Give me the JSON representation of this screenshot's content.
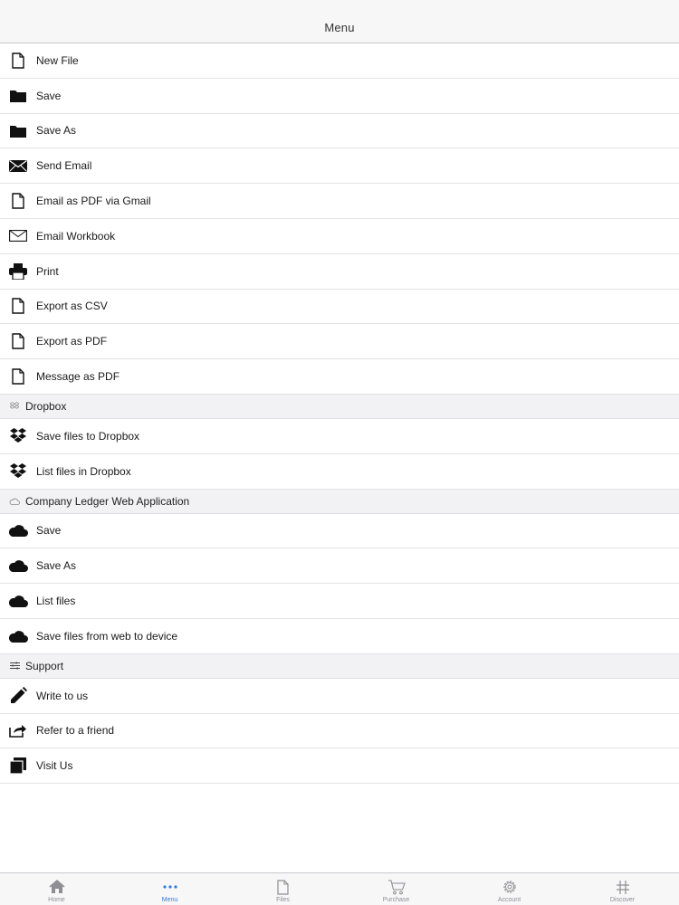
{
  "nav": {
    "title": "Menu"
  },
  "menu": {
    "file_items": [
      {
        "label": "New File",
        "icon": "file-icon"
      },
      {
        "label": "Save",
        "icon": "folder-icon"
      },
      {
        "label": "Save As",
        "icon": "folder-icon"
      },
      {
        "label": "Send Email",
        "icon": "envelope-filled-icon"
      },
      {
        "label": "Email as PDF via Gmail",
        "icon": "file-icon"
      },
      {
        "label": "Email Workbook",
        "icon": "envelope-outline-icon"
      },
      {
        "label": "Print",
        "icon": "printer-icon"
      },
      {
        "label": "Export as CSV",
        "icon": "file-icon"
      },
      {
        "label": "Export as PDF",
        "icon": "file-icon"
      },
      {
        "label": "Message as PDF",
        "icon": "file-icon"
      }
    ],
    "dropbox_section": {
      "title": "Dropbox",
      "items": [
        {
          "label": "Save files to Dropbox",
          "icon": "dropbox-icon"
        },
        {
          "label": "List files in Dropbox",
          "icon": "dropbox-icon"
        }
      ]
    },
    "web_section": {
      "title": "Company Ledger Web Application",
      "items": [
        {
          "label": "Save",
          "icon": "cloud-icon"
        },
        {
          "label": "Save As",
          "icon": "cloud-icon"
        },
        {
          "label": "List files",
          "icon": "cloud-icon"
        },
        {
          "label": "Save files from web to device",
          "icon": "cloud-icon"
        }
      ]
    },
    "support_section": {
      "title": "Support",
      "items": [
        {
          "label": "Write to us",
          "icon": "pencil-icon"
        },
        {
          "label": "Refer to a friend",
          "icon": "share-icon"
        },
        {
          "label": "Visit Us",
          "icon": "copy-icon"
        }
      ]
    }
  },
  "tabs": [
    {
      "label": "Home",
      "icon": "home-icon",
      "active": false
    },
    {
      "label": "Menu",
      "icon": "more-dots-icon",
      "active": true
    },
    {
      "label": "Files",
      "icon": "file-icon",
      "active": false
    },
    {
      "label": "Purchase",
      "icon": "cart-icon",
      "active": false
    },
    {
      "label": "Account",
      "icon": "gear-icon",
      "active": false
    },
    {
      "label": "Discover",
      "icon": "hash-icon",
      "active": false
    }
  ],
  "colors": {
    "accent": "#2f7de1",
    "inactive": "#8e8e93",
    "separator": "#e3e3e6",
    "section_bg": "#f2f2f4"
  }
}
